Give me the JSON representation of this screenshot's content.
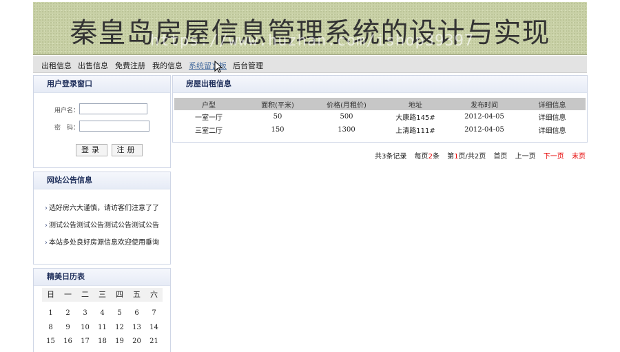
{
  "banner": {
    "title": "秦皇岛房屋信息管理系统的设计与实现",
    "watermark": "https://www.huzhan.com/ishop39397"
  },
  "nav": {
    "items": [
      "出租信息",
      "出售信息",
      "免费注册",
      "我的信息",
      "系统留言板",
      "后台管理"
    ],
    "active_index": 4
  },
  "login": {
    "title": "用户登录窗口",
    "username_label": "用户名：",
    "password_label": "密　码：",
    "login_button": "登录",
    "register_button": "注册"
  },
  "notice": {
    "title": "网站公告信息",
    "items": [
      "选好房六大谨慎，请访客们注意了了",
      "测试公告测试公告测试公告测试公告",
      "本站多处良好房源信息欢迎使用垂询"
    ]
  },
  "calendar": {
    "title": "精美日历表",
    "weekdays": [
      "日",
      "一",
      "二",
      "三",
      "四",
      "五",
      "六"
    ],
    "weeks": [
      [
        "1",
        "2",
        "3",
        "4",
        "5",
        "6",
        "7"
      ],
      [
        "8",
        "9",
        "10",
        "11",
        "12",
        "13",
        "14"
      ],
      [
        "15",
        "16",
        "17",
        "18",
        "19",
        "20",
        "21"
      ]
    ]
  },
  "listing": {
    "title": "房屋出租信息",
    "headers": [
      "户型",
      "面积(平米)",
      "价格(月租价)",
      "地址",
      "发布时间",
      "详细信息"
    ],
    "rows": [
      [
        "一室一厅",
        "50",
        "500",
        "大康路145#",
        "2012-04-05",
        "详细信息"
      ],
      [
        "三室二厅",
        "150",
        "1300",
        "上清路111#",
        "2012-04-05",
        "详细信息"
      ]
    ]
  },
  "pager": {
    "total_prefix": "共",
    "total_count": "3",
    "total_suffix": "条记录",
    "per_page_prefix": "每页",
    "per_page": "2",
    "per_page_suffix": "条",
    "page_prefix": "第",
    "current_page": "1",
    "page_mid": "页/共",
    "total_pages": "2",
    "page_suffix": "页",
    "first": "首页",
    "prev": "上一页",
    "next": "下一页",
    "last": "末页"
  },
  "colors": {
    "accent_red": "#e60000",
    "panel_title": "#1e2e5a",
    "banner_bg": "#c9d1a7"
  }
}
